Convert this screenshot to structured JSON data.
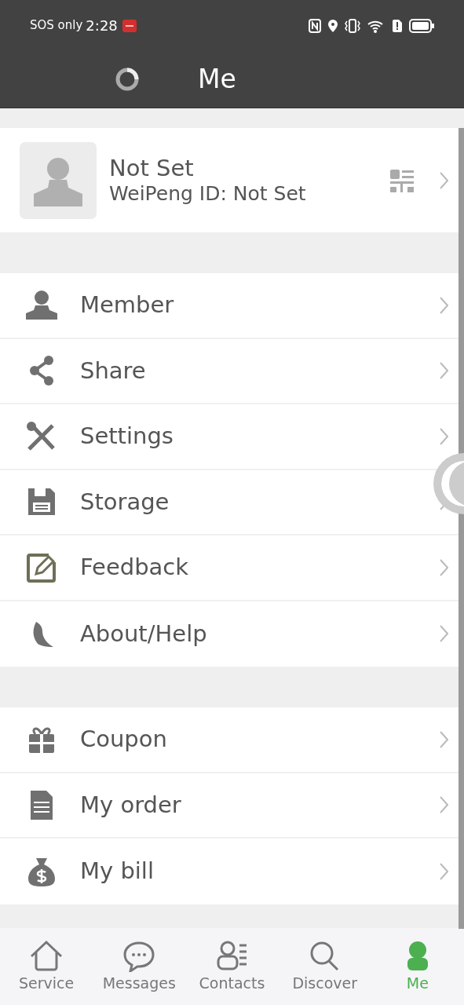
{
  "status_bar": {
    "carrier": "SOS only",
    "time": "2:28"
  },
  "header": {
    "title": "Me"
  },
  "profile": {
    "name": "Not Set",
    "id_line": "WeiPeng ID: Not Set"
  },
  "menu_groups": [
    [
      {
        "label": "Member"
      },
      {
        "label": "Share"
      },
      {
        "label": "Settings"
      },
      {
        "label": "Storage"
      },
      {
        "label": "Feedback"
      },
      {
        "label": "About/Help"
      }
    ],
    [
      {
        "label": "Coupon"
      },
      {
        "label": "My order"
      },
      {
        "label": "My bill"
      }
    ]
  ],
  "tab_bar": [
    {
      "label": "Service",
      "selected": false
    },
    {
      "label": "Messages",
      "selected": false
    },
    {
      "label": "Contacts",
      "selected": false
    },
    {
      "label": "Discover",
      "selected": false
    },
    {
      "label": "Me",
      "selected": true
    }
  ]
}
